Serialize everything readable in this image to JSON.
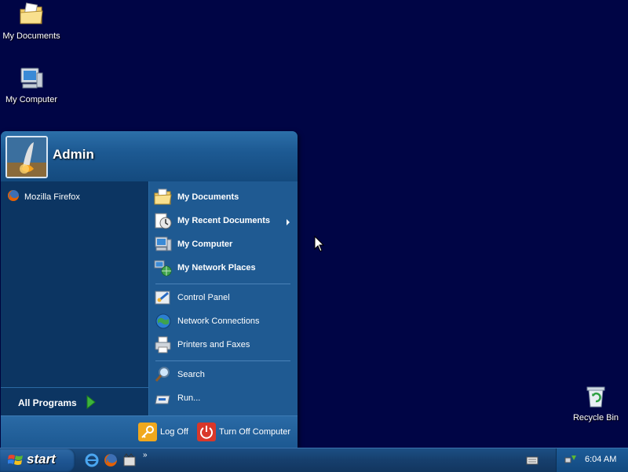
{
  "desktop": {
    "icons": [
      {
        "label": "My Documents",
        "icon": "folder-documents-icon"
      },
      {
        "label": "My Computer",
        "icon": "computer-icon"
      },
      {
        "label": "Recycle Bin",
        "icon": "recycle-bin-icon"
      }
    ]
  },
  "start_menu": {
    "user": {
      "name": "Admin",
      "avatar": "user-avatar-rocket"
    },
    "pinned": [
      {
        "label": "Mozilla Firefox",
        "icon": "firefox-icon"
      }
    ],
    "all_programs_label": "All Programs",
    "right_items": [
      {
        "label": "My Documents",
        "icon": "my-documents-icon",
        "bold": true
      },
      {
        "label": "My Recent Documents",
        "icon": "recent-documents-icon",
        "bold": true,
        "has_submenu": true
      },
      {
        "label": "My Computer",
        "icon": "my-computer-icon",
        "bold": true
      },
      {
        "label": "My Network Places",
        "icon": "network-places-icon",
        "bold": true
      },
      {
        "label": "Control Panel",
        "icon": "control-panel-icon",
        "bold": false
      },
      {
        "label": "Network Connections",
        "icon": "network-connections-icon",
        "bold": false
      },
      {
        "label": "Printers and Faxes",
        "icon": "printer-icon",
        "bold": false
      },
      {
        "label": "Search",
        "icon": "search-icon",
        "bold": false
      },
      {
        "label": "Run...",
        "icon": "run-icon",
        "bold": false
      }
    ],
    "footer": {
      "log_off_label": "Log Off",
      "turn_off_label": "Turn Off Computer"
    }
  },
  "taskbar": {
    "start_label": "start",
    "quick_launch": [
      "internet-explorer-icon",
      "firefox-icon",
      "media-icon"
    ],
    "more_glyph": "»",
    "tray": {
      "time": "6:04 AM"
    }
  },
  "colors": {
    "desktop_bg": "#000545",
    "menu_right_bg": "#1f5a92",
    "menu_left_bg": "#0c3562"
  }
}
